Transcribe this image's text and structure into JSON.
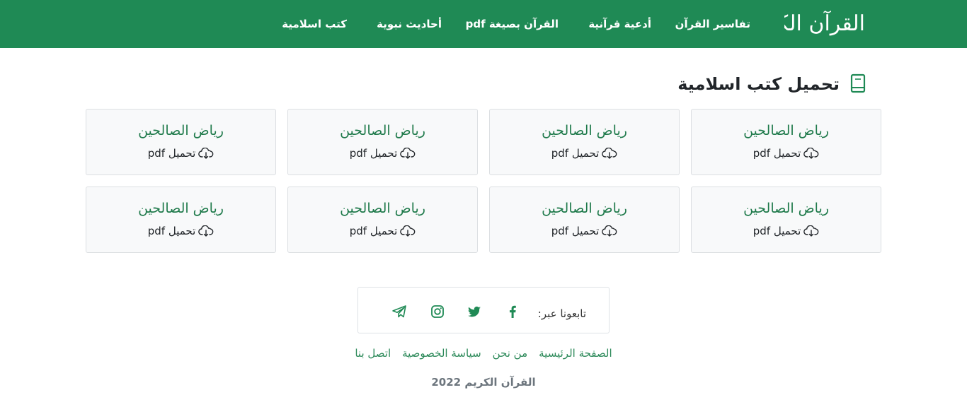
{
  "header": {
    "logo_text": "القرآن الكريم",
    "nav": [
      {
        "label": "تفاسير القرآن"
      },
      {
        "label": "أدعية قرآنية"
      },
      {
        "label": "القرآن بصيغة pdf"
      },
      {
        "label": "أحاديث نبوية"
      },
      {
        "label": "كتب اسلامية"
      }
    ]
  },
  "main": {
    "title": "تحميل كتب اسلامية",
    "title_icon": "book-icon",
    "books": [
      {
        "title": "رياض الصالحين",
        "download_label": "تحميل pdf",
        "icon": "cloud-download-icon"
      },
      {
        "title": "رياض الصالحين",
        "download_label": "تحميل pdf",
        "icon": "cloud-download-icon"
      },
      {
        "title": "رياض الصالحين",
        "download_label": "تحميل pdf",
        "icon": "cloud-download-icon"
      },
      {
        "title": "رياض الصالحين",
        "download_label": "تحميل pdf",
        "icon": "cloud-download-icon"
      },
      {
        "title": "رياض الصالحين",
        "download_label": "تحميل pdf",
        "icon": "cloud-download-icon"
      },
      {
        "title": "رياض الصالحين",
        "download_label": "تحميل pdf",
        "icon": "cloud-download-icon"
      },
      {
        "title": "رياض الصالحين",
        "download_label": "تحميل pdf",
        "icon": "cloud-download-icon"
      },
      {
        "title": "رياض الصالحين",
        "download_label": "تحميل pdf",
        "icon": "cloud-download-icon"
      }
    ]
  },
  "footer": {
    "follow_label": "تابعونا عبر:",
    "social": [
      "facebook-icon",
      "twitter-icon",
      "instagram-icon",
      "telegram-icon"
    ],
    "links": [
      {
        "label": "الصفحة الرئيسية"
      },
      {
        "label": "من نحن"
      },
      {
        "label": "سياسة الخصوصية"
      },
      {
        "label": "اتصل بنا"
      }
    ],
    "copyright": "القرآن الكريم 2022"
  },
  "colors": {
    "brand_green": "#1f8a55",
    "card_title_green": "#1f7a4b",
    "card_bg": "#f8f9fa",
    "muted_text": "#6c757d"
  }
}
